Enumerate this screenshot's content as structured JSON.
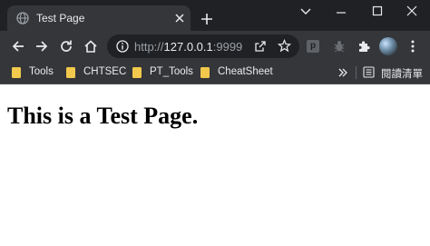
{
  "tab": {
    "title": "Test Page"
  },
  "toolbar": {
    "url_scheme": "http://",
    "url_host": "127.0.0.1",
    "url_port": ":9999",
    "extension_p_label": "p"
  },
  "bookmarks": {
    "items": [
      {
        "label": "Tools"
      },
      {
        "label": "CHTSEC"
      },
      {
        "label": "PT_Tools"
      },
      {
        "label": "CheatSheet"
      }
    ],
    "reading_list_label": "閱讀清單"
  },
  "page": {
    "heading": "This is a Test Page."
  },
  "colors": {
    "frame": "#202124",
    "toolbar": "#35363a",
    "text": "#e8eaed",
    "folder": "#f2c94c"
  },
  "icons": [
    "globe-icon",
    "close-icon",
    "plus-icon",
    "chevron-down-icon",
    "minimize-icon",
    "maximize-icon",
    "back-arrow-icon",
    "forward-arrow-icon",
    "reload-icon",
    "home-icon",
    "info-icon",
    "share-icon",
    "star-icon",
    "puzzle-icon",
    "kebab-menu-icon",
    "folder-icon",
    "double-chevron-icon",
    "reading-list-icon"
  ]
}
